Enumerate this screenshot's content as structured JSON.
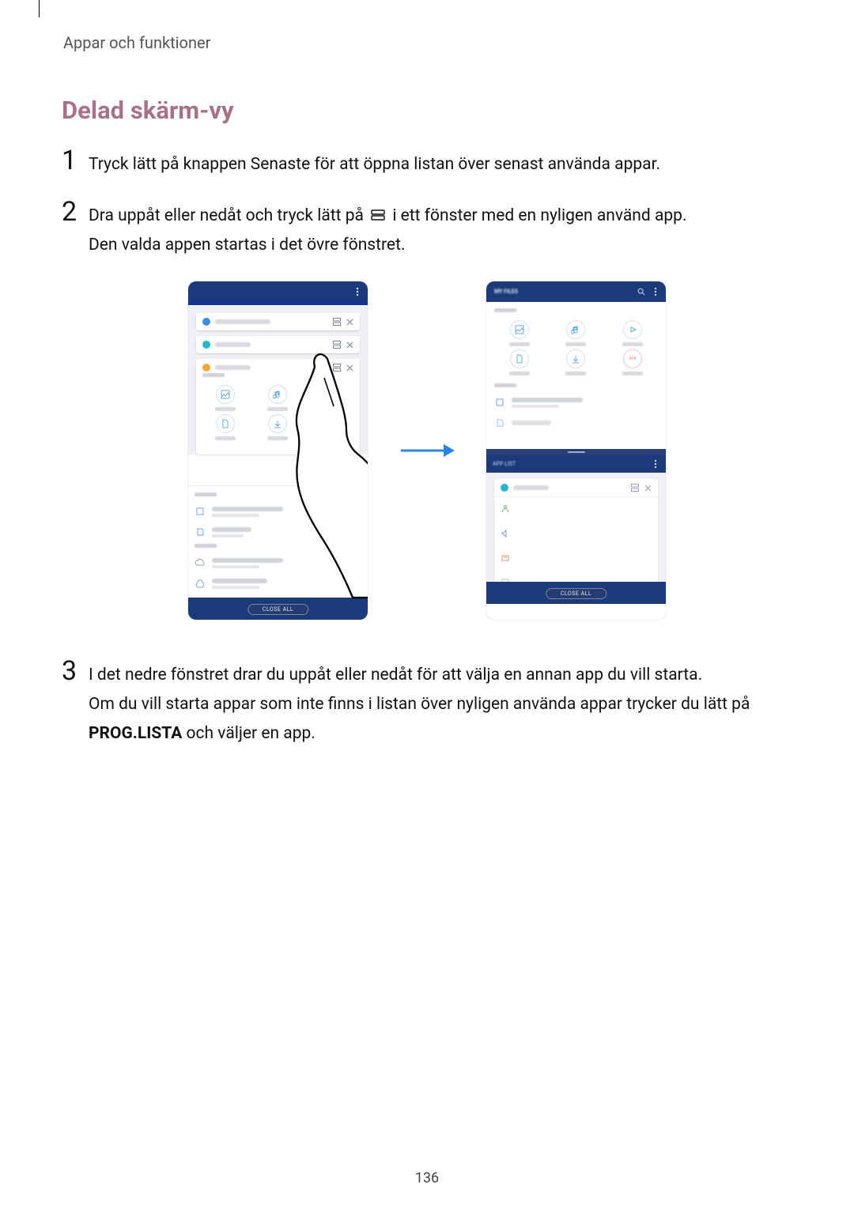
{
  "breadcrumb": "Appar och funktioner",
  "section_title": "Delad skärm-vy",
  "steps": {
    "1": "Tryck lätt på knappen Senaste för att öppna listan över senast använda appar.",
    "2a": "Dra uppåt eller nedåt och tryck lätt på ",
    "2b": " i ett fönster med en nyligen använd app.",
    "2c": "Den valda appen startas i det övre fönstret.",
    "3a": "I det nedre fönstret drar du uppåt eller nedåt för att välja en annan app du vill starta.",
    "3b": "Om du vill starta appar som inte finns i listan över nyligen använda appar trycker du lätt på ",
    "3c": " och väljer en app.",
    "3_bold": "PROG.LISTA"
  },
  "buttons": {
    "close_all_a": "CLOSE ALL",
    "close_all_b": "CLOSE ALL"
  },
  "page_number": "136"
}
